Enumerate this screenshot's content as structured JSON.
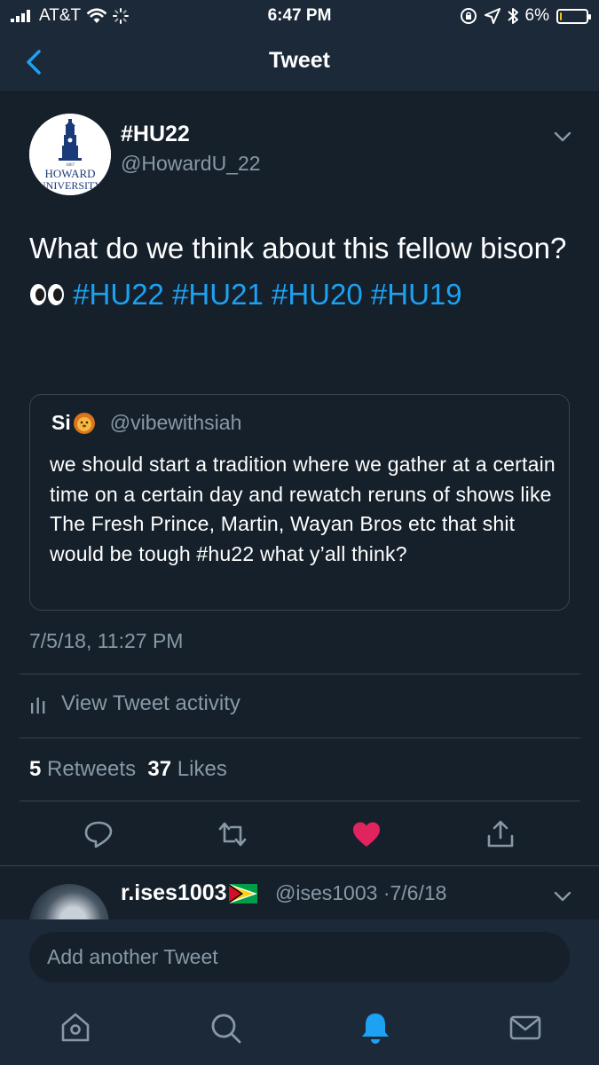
{
  "status_bar": {
    "carrier": "AT&T",
    "time": "6:47 PM",
    "battery_percent": "6%",
    "battery_level": 0.06
  },
  "nav": {
    "title": "Tweet",
    "back_icon": "chevron-left-icon"
  },
  "tweet": {
    "display_name": "#HU22",
    "handle": "@HowardU_22",
    "avatar_logo": {
      "year": "1867",
      "line1": "HOWARD",
      "line2": "UNIVERSITY"
    },
    "text_before": "What do we think about this fellow bison? ",
    "emoji": "eyes-emoji",
    "hashtags": [
      "#HU22",
      "#HU21",
      "#HU20",
      "#HU19"
    ],
    "quoted": {
      "name": "Si",
      "name_emoji": "lion-face-emoji",
      "handle": "@vibewithsiah",
      "text": "we should start a tradition where we gather at a certain time on a certain day and rewatch reruns of shows like The Fresh Prince, Martin, Wayan Bros etc that shit would be tough #hu22 what y’all think?"
    },
    "timestamp": "7/5/18, 11:27 PM",
    "activity_label": "View Tweet activity",
    "retweet_count": "5",
    "retweets_label": "Retweets",
    "like_count": "37",
    "likes_label": "Likes",
    "liked": true
  },
  "reply": {
    "display_name": "r.ises1003",
    "flag": "guyana-flag",
    "handle": "@ises1003",
    "date": "7/6/18"
  },
  "compose": {
    "placeholder": "Add another Tweet"
  },
  "tabs": [
    {
      "icon": "home-icon",
      "active": false
    },
    {
      "icon": "search-icon",
      "active": false
    },
    {
      "icon": "notifications-bell-icon",
      "active": true
    },
    {
      "icon": "messages-envelope-icon",
      "active": false
    }
  ],
  "colors": {
    "background": "#15202b",
    "bar": "#1c2938",
    "accent": "#1da1f2",
    "secondary_text": "#8899a6",
    "like": "#e0245e",
    "battery": "#f5c518"
  }
}
